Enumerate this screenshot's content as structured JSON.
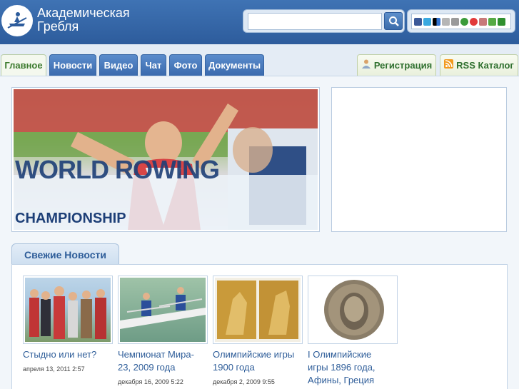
{
  "header": {
    "logo_line1": "Академическая",
    "logo_line2": "Гребля",
    "search_placeholder": "",
    "social_icons": [
      "facebook-icon",
      "twitter-icon",
      "delicious-icon",
      "digg-icon",
      "stumbleupon-icon",
      "technorati-icon",
      "reddit-icon",
      "myspace-icon",
      "livejournal-icon",
      "evernote-icon"
    ]
  },
  "nav": {
    "tabs": [
      "Главное",
      "Новости",
      "Видео",
      "Чат",
      "Фото",
      "Документы"
    ],
    "right_tabs": [
      "Регистрация",
      "RSS Каталог"
    ]
  },
  "hero": {
    "banner_lines": [
      "WORLD ROWING",
      "CHAMPIONSHIP"
    ]
  },
  "news": {
    "section_title": "Свежие Новости",
    "items": [
      {
        "title_lines": [
          "Стыдно или нет?"
        ],
        "date": "апреля 13, 2011 2:57"
      },
      {
        "title_lines": [
          "Чемпионат Мира-",
          "23, 2009 года"
        ],
        "date": "декабря 16, 2009 5:22"
      },
      {
        "title_lines": [
          "Олимпийские игры",
          "1900 года"
        ],
        "date": "декабря 2, 2009 9:55"
      },
      {
        "title_lines": [
          "I Олимпийские",
          "игры 1896 года,",
          "Афины, Греция"
        ],
        "date": ""
      }
    ]
  },
  "colors": {
    "header_blue": "#3a6aad",
    "link_blue": "#2e5d99",
    "active_tab_green": "#3c7a2e"
  }
}
